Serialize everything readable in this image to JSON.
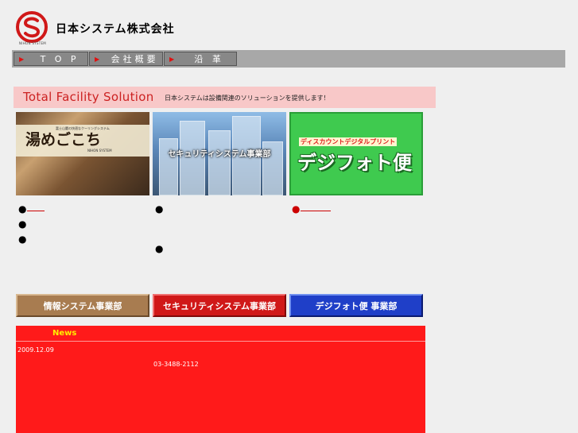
{
  "header": {
    "company_name": "日本システム株式会社",
    "logo_subtext": "NIHON SYSTEM"
  },
  "nav": {
    "items": [
      {
        "label": "T O P"
      },
      {
        "label": "会社概要"
      },
      {
        "label": "沿 革"
      }
    ],
    "bullet_icon": "triangle-right-icon"
  },
  "banner": {
    "title": "Total Facility Solution",
    "subtitle": "日本システムは設備関連のソリューションを提供します！"
  },
  "panels": {
    "yume": {
      "top_text": "富士山麓の快適なクーリングシステム",
      "main_text": "湯めごこち",
      "small_text": "NIHON SYSTEM"
    },
    "security": {
      "main_text": "セキュリティシステム事業部"
    },
    "digi": {
      "top_text": "ディスカウントデジタルプリント",
      "main_text": "デジフォト便"
    }
  },
  "departments": {
    "info": "情報システム事業部",
    "security": "セキュリティシステム事業部",
    "digi": "デジフォト便 事業部"
  },
  "news": {
    "title": "News",
    "date": "2009.12.09",
    "tel": "03-3488-2112"
  },
  "colors": {
    "nav_bar": "#a8a8a8",
    "banner_bg": "#f8c8c8",
    "banner_text": "#cc2222",
    "news_bg": "#ff1a1a",
    "news_title": "#ffee00"
  }
}
